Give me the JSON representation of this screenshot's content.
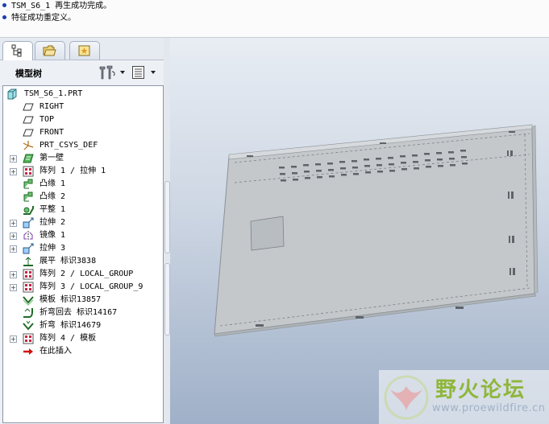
{
  "messages": [
    {
      "text": "TSM_S6_1 再生成功完成。"
    },
    {
      "text": "特征成功重定义。"
    }
  ],
  "model_tree": {
    "title": "模型树",
    "items": [
      {
        "label": "TSM_S6_1.PRT",
        "icon": "part-icon",
        "expandable": false
      },
      {
        "label": "RIGHT",
        "icon": "datum-plane-icon",
        "expandable": false
      },
      {
        "label": "TOP",
        "icon": "datum-plane-icon",
        "expandable": false
      },
      {
        "label": "FRONT",
        "icon": "datum-plane-icon",
        "expandable": false
      },
      {
        "label": "PRT_CSYS_DEF",
        "icon": "csys-icon",
        "expandable": false
      },
      {
        "label": "第一壁",
        "icon": "first-wall-icon",
        "expandable": true
      },
      {
        "label": "阵列 1 / 拉伸 1",
        "icon": "pattern-icon",
        "expandable": true
      },
      {
        "label": "凸缘 1",
        "icon": "flange-icon",
        "expandable": false
      },
      {
        "label": "凸缘 2",
        "icon": "flange-icon",
        "expandable": false
      },
      {
        "label": "平整 1",
        "icon": "flat-wall-icon",
        "expandable": false
      },
      {
        "label": "拉伸 2",
        "icon": "extrude-icon",
        "expandable": true
      },
      {
        "label": "镜像 1",
        "icon": "mirror-icon",
        "expandable": true
      },
      {
        "label": "拉伸 3",
        "icon": "extrude-icon",
        "expandable": true
      },
      {
        "label": "展平 标识3838",
        "icon": "unbend-icon",
        "expandable": false
      },
      {
        "label": "阵列 2 / LOCAL_GROUP",
        "icon": "pattern-icon",
        "expandable": true
      },
      {
        "label": "阵列 3 / LOCAL_GROUP_9",
        "icon": "pattern-icon",
        "expandable": true
      },
      {
        "label": "模板 标识13857",
        "icon": "form-icon",
        "expandable": false
      },
      {
        "label": "折弯回去 标识14167",
        "icon": "bend-back-icon",
        "expandable": false
      },
      {
        "label": "折弯 标识14679",
        "icon": "bend-icon",
        "expandable": false
      },
      {
        "label": "阵列 4 / 模板",
        "icon": "pattern-icon",
        "expandable": true
      },
      {
        "label": "在此插入",
        "icon": "insert-here-icon",
        "expandable": false
      }
    ]
  },
  "watermark": {
    "title": "野火论坛",
    "url": "www.proewildfire.cn"
  }
}
